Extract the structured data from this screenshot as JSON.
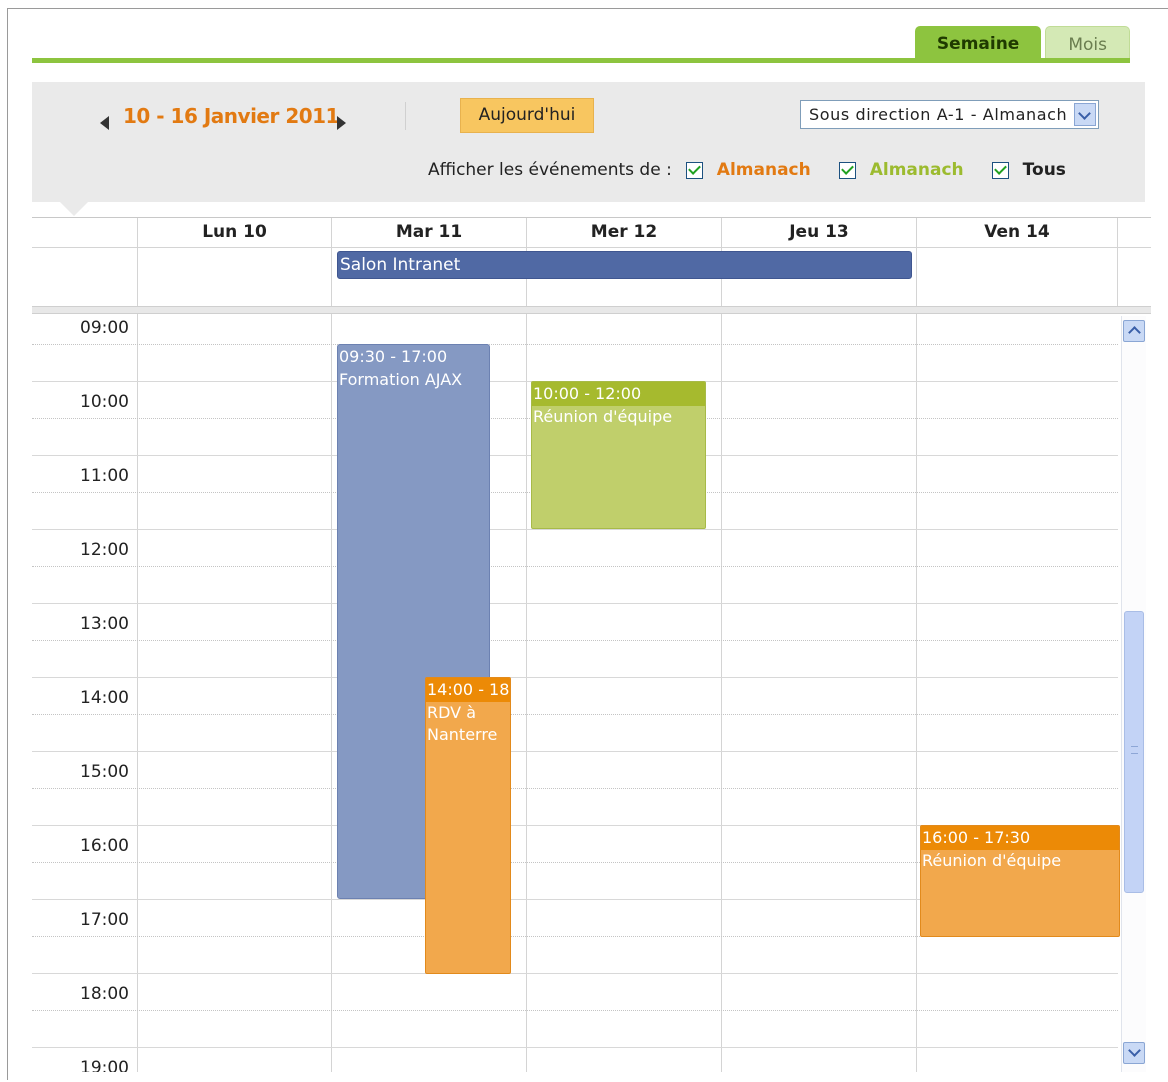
{
  "tabs": {
    "week": "Semaine",
    "month": "Mois"
  },
  "toolbar": {
    "date_range": "10 - 16 Janvier 2011",
    "today_button": "Aujourd'hui",
    "calendar_select": "Sous direction A-1 - Almanach",
    "filter_label": "Afficher les événements de :",
    "filters": [
      {
        "label": "Almanach",
        "color": "#e27a12",
        "checked": true
      },
      {
        "label": "Almanach",
        "color": "#9cbb2f",
        "checked": true
      },
      {
        "label": "Tous",
        "color": "#222222",
        "checked": true
      }
    ]
  },
  "days": [
    "Lun 10",
    "Mar 11",
    "Mer 12",
    "Jeu 13",
    "Ven 14"
  ],
  "hours": [
    "09:00",
    "10:00",
    "11:00",
    "12:00",
    "13:00",
    "14:00",
    "15:00",
    "16:00",
    "17:00",
    "18:00",
    "19:00"
  ],
  "all_day_events": [
    {
      "title": "Salon Intranet",
      "color": "#5069a4"
    }
  ],
  "events": [
    {
      "time": "09:30 - 17:00",
      "title": "Formation AJAX",
      "color": "#8599c3"
    },
    {
      "time": "10:00 - 12:00",
      "title": "Réunion d'équipe",
      "color": "#c0cf6b"
    },
    {
      "time": "14:00 - 18",
      "title": "RDV à Nanterre",
      "color": "#f2a84c"
    },
    {
      "time": "16:00 - 17:30",
      "title": "Réunion d'équipe",
      "color": "#f2a84c"
    }
  ]
}
